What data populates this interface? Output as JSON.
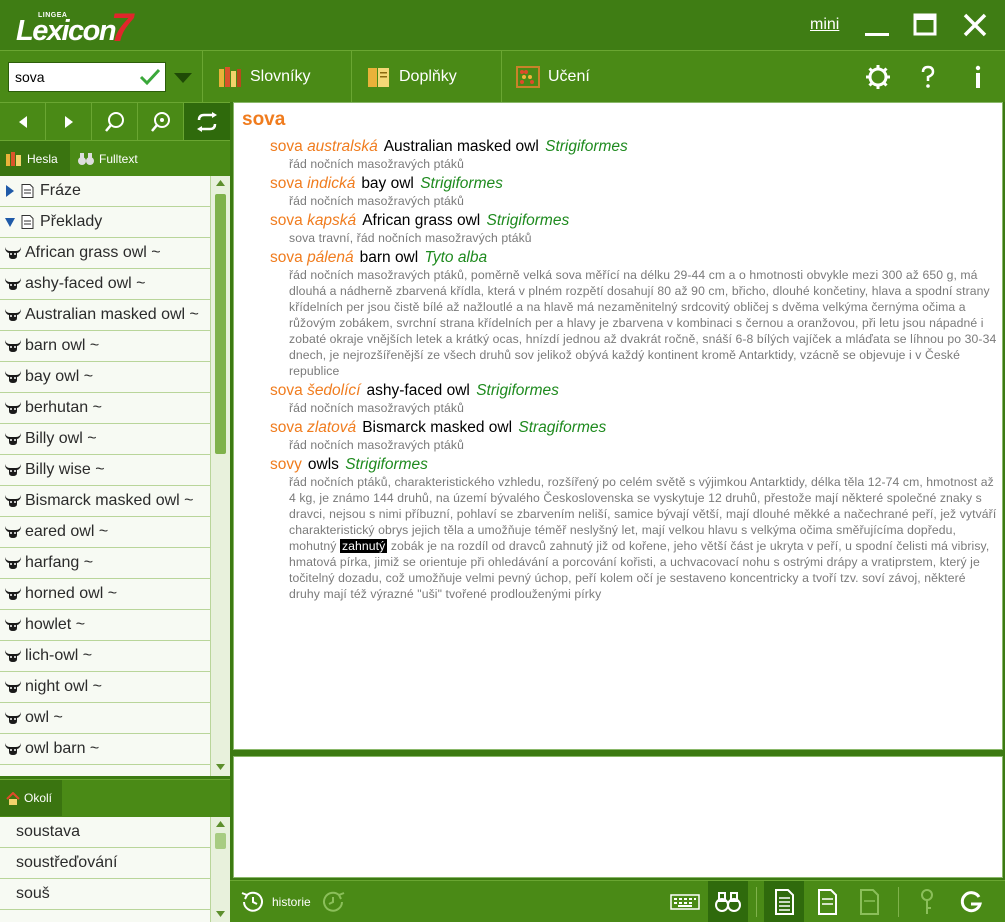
{
  "app": {
    "logo_small": "LINGEA",
    "logo_word": "Lexicon",
    "logo_number": "7",
    "mini_label": "mini"
  },
  "toolbar": {
    "search_value": "sova",
    "slovniky": "Slovníky",
    "doplnky": "Doplňky",
    "uceni": "Učení"
  },
  "tabs": {
    "hesla": "Hesla",
    "fulltext": "Fulltext",
    "okoli": "Okolí"
  },
  "wordlist": {
    "groups": [
      "Fráze",
      "Překlady"
    ],
    "items": [
      "African grass owl ~",
      "ashy-faced owl ~",
      "Australian masked owl ~",
      "barn owl ~",
      "bay owl ~",
      "berhutan ~",
      "Billy owl ~",
      "Billy wise ~",
      "Bismarck masked owl ~",
      "eared owl ~",
      "harfang ~",
      "horned owl ~",
      "howlet ~",
      "lich-owl ~",
      "night owl ~",
      "owl ~",
      "owl barn ~"
    ]
  },
  "okoli": {
    "items": [
      "soustava",
      "soustřeďování",
      "souš"
    ]
  },
  "entry": {
    "headword": "sova",
    "senses": [
      {
        "pre": "sova ",
        "hw": "australská",
        "tr": "Australian masked owl",
        "lat": "Strigiformes",
        "desc": "řád nočních masožravých ptáků"
      },
      {
        "pre": "sova ",
        "hw": "indická",
        "tr": "bay owl",
        "lat": "Strigiformes",
        "desc": "řád nočních masožravých ptáků"
      },
      {
        "pre": "sova ",
        "hw": "kapská",
        "tr": "African grass owl",
        "lat": "Strigiformes",
        "desc": "sova travní, řád nočních masožravých ptáků"
      },
      {
        "pre": "sova ",
        "hw": "pálená",
        "tr": "barn owl",
        "lat": "Tyto alba",
        "desc": "řád nočních masožravých ptáků, poměrně velká sova měřící na délku 29-44 cm a o hmotnosti obvykle mezi 300 až 650 g, má dlouhá a nádherně zbarvená křídla, která v plném rozpětí dosahují 80 až 90 cm, břicho, dlouhé končetiny, hlava a spodní strany křídelních per jsou čistě bílé až nažloutlé a na hlavě má nezaměnitelný srdcovitý obličej s dvěma velkýma černýma očima a růžovým zobákem, svrchní strana křídelních per a hlavy je zbarvena v kombinaci s černou a oranžovou, při letu jsou nápadné i zobaté okraje vnějších letek a krátký ocas, hnízdí jednou až dvakrát ročně, snáší 6-8 bílých vajíček a mláďata se líhnou po 30-34 dnech, je nejrozšířenější ze všech druhů sov jelikož obývá každý kontinent kromě Antarktidy, vzácně se objevuje i v České republice"
      },
      {
        "pre": "sova ",
        "hw": "šedolící",
        "tr": "ashy-faced owl",
        "lat": "Strigiformes",
        "desc": "řád nočních masožravých ptáků"
      },
      {
        "pre": "sova ",
        "hw": "zlatová",
        "tr": "Bismarck masked owl",
        "lat": "Stragiformes",
        "desc": "řád nočních masožravých ptáků"
      }
    ],
    "sovy": {
      "hw": "sovy",
      "tr": "owls",
      "lat": "Strigiformes",
      "desc_before": "řád nočních ptáků, charakteristického vzhledu, rozšířený po celém světě s výjimkou Antarktidy, délka těla 12-74 cm, hmotnost až 4 kg, je známo 144 druhů, na území bývalého Československa se vyskytuje 12 druhů, přestože mají některé společné znaky s dravci, nejsou s nimi příbuzní, pohlaví se zbarvením neliší, samice bývají větší, mají dlouhé měkké a načechrané peří, jež vytváří charakteristický obrys jejich těla a umožňuje téměř neslyšný let, mají velkou hlavu s velkýma očima směřujícíma dopředu, mohutný ",
      "highlight": "zahnutý",
      "desc_after": " zobák je na rozdíl od dravců zahnutý již od kořene, jeho větší část je ukryta v peří, u spodní čelisti má vibrisy, hmatová pírka, jimiž se orientuje při ohledávání a porcování kořisti, a uchvacovací nohu s ostrými drápy a vratiprstem, který je točitelný dozadu, což umožňuje velmi pevný úchop, peří kolem očí je sestaveno koncentricky a tvoří tzv. soví závoj, některé druhy mají též výrazné \"uši\" tvořené prodlouženými pírky"
    }
  },
  "bottom": {
    "historie": "historie"
  },
  "colors": {
    "green_dark": "#3f7d14",
    "green_bar": "#4a8a16",
    "orange": "#f07c1e",
    "latin_green": "#1e8a1e"
  }
}
